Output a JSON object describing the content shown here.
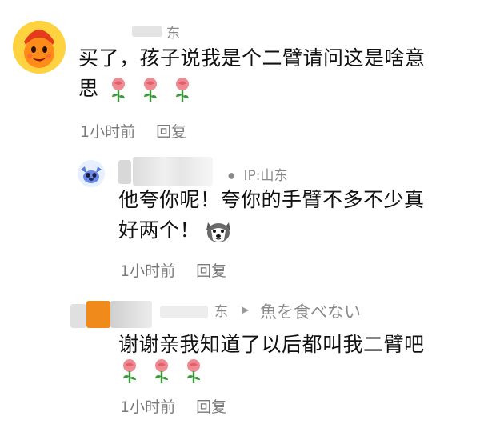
{
  "comment1": {
    "username": "东",
    "text_line1": "买了，孩子说我是个二臂请问这是啥意",
    "text_line2": "思",
    "time": "1小时前",
    "reply": "回复",
    "emoji_count": 3
  },
  "reply1": {
    "username_tail": "IP:山东",
    "text_line1": "他夸你呢！夸你的手臂不多不少真",
    "text_line2": "好两个！",
    "time": "1小时前",
    "reply": "回复"
  },
  "reply2": {
    "username": "东",
    "reply_target": "魚を食べない",
    "text": "谢谢亲我知道了以后都叫我二臂吧",
    "time": "1小时前",
    "reply": "回复",
    "emoji_count": 3
  },
  "colors": {
    "meta": "#7a7a7a",
    "name": "#8a8a8a",
    "avatar": "#ffd23f",
    "rose": "#f08a92"
  },
  "icons": [
    "rose-emoji-icon",
    "husky-emoji-icon",
    "reply-arrow-icon"
  ]
}
